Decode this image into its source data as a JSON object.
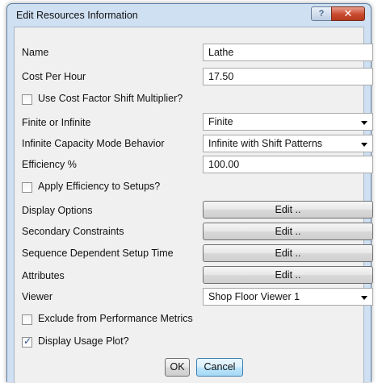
{
  "window": {
    "title": "Edit Resources Information",
    "help_glyph": "?",
    "close_glyph": "✕"
  },
  "form": {
    "name": {
      "label": "Name",
      "value": "Lathe"
    },
    "cost_per_hour": {
      "label": "Cost Per Hour",
      "value": "17.50"
    },
    "use_cost_factor": {
      "label": "Use Cost Factor Shift Multiplier?",
      "checked": false
    },
    "finite_or_infinite": {
      "label": "Finite or Infinite",
      "value": "Finite"
    },
    "infinite_mode": {
      "label": "Infinite Capacity Mode Behavior",
      "value": "Infinite with Shift Patterns"
    },
    "efficiency": {
      "label": "Efficiency %",
      "value": "100.00"
    },
    "apply_efficiency": {
      "label": "Apply Efficiency to Setups?",
      "checked": false
    },
    "display_options": {
      "label": "Display Options",
      "button": "Edit .."
    },
    "secondary_constraints": {
      "label": "Secondary Constraints",
      "button": "Edit .."
    },
    "sequence_setup": {
      "label": "Sequence Dependent Setup Time",
      "button": "Edit .."
    },
    "attributes": {
      "label": "Attributes",
      "button": "Edit .."
    },
    "viewer": {
      "label": "Viewer",
      "value": "Shop Floor Viewer 1"
    },
    "exclude_metrics": {
      "label": "Exclude from Performance Metrics",
      "checked": false
    },
    "display_usage_plot": {
      "label": "Display Usage Plot?",
      "checked": true
    }
  },
  "buttons": {
    "ok": "OK",
    "cancel": "Cancel"
  },
  "icons": {
    "check": "✓"
  }
}
